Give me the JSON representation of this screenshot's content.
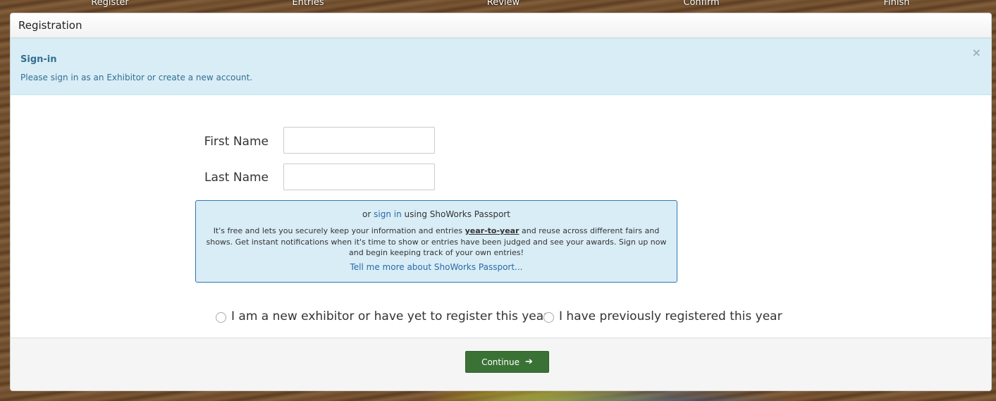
{
  "steps": [
    "Register",
    "Entries",
    "Review",
    "Confirm",
    "Finish"
  ],
  "panel": {
    "title": "Registration"
  },
  "alert": {
    "title": "Sign-in",
    "text": "Please sign in as an Exhibitor or create a new account.",
    "close": "×"
  },
  "form": {
    "first_name_label": "First Name",
    "last_name_label": "Last Name",
    "first_name_value": "",
    "last_name_value": ""
  },
  "passport": {
    "prefix": "or",
    "sign_in_link": "sign in",
    "suffix": "using ShoWorks Passport",
    "desc_before": "It's free and lets you securely keep your information and entries",
    "desc_bold": "year-to-year",
    "desc_after": "and reuse across different fairs and shows. Get instant notifications when it's time to show or entries have been judged and see your awards. Sign up now and begin keeping track of your own entries!",
    "more_link": "Tell me more about ShoWorks Passport..."
  },
  "radios": {
    "new_exhibitor": "I am a new exhibitor or have yet to register this year",
    "previously_registered": "I have previously registered this year"
  },
  "footer": {
    "continue_label": "Continue",
    "continue_icon": "arrow-right-icon"
  },
  "colors": {
    "alert_bg": "#d9edf7",
    "alert_text": "#31708f",
    "continue_bg": "#3a7236",
    "link": "#2a6aa6"
  }
}
